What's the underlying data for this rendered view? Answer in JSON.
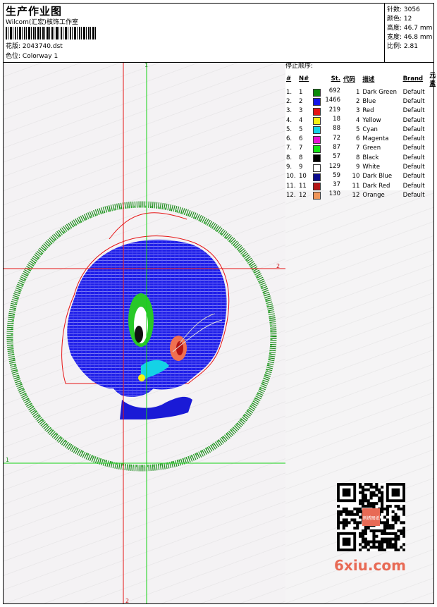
{
  "header": {
    "title": "生产作业图",
    "company": "Wilcom(汇宏)核饰工作室",
    "design_label": "花版:",
    "design_file": "2043740.dst",
    "colorway_label": "色位:",
    "colorway": "Colorway 1"
  },
  "stats": {
    "stitches_label": "针数:",
    "stitches": "3056",
    "colors_label": "颜色:",
    "colors": "12",
    "height_label": "高度:",
    "height": "46.7 mm",
    "width_label": "宽度:",
    "width": "46.8 mm",
    "ratio_label": "比例:",
    "ratio": "2.81"
  },
  "stop_sequence": {
    "title": "停止顺序:",
    "headers": [
      "#",
      "N#",
      "St.",
      "代码",
      "描述",
      "Brand",
      "元素"
    ],
    "rows": [
      {
        "idx": "1.",
        "n": "1",
        "st": "692",
        "code": "1",
        "desc": "Dark Green",
        "brand": "Default",
        "color": "#0a8a0a"
      },
      {
        "idx": "2.",
        "n": "2",
        "st": "1466",
        "code": "2",
        "desc": "Blue",
        "brand": "Default",
        "color": "#1414e6"
      },
      {
        "idx": "3.",
        "n": "3",
        "st": "219",
        "code": "3",
        "desc": "Red",
        "brand": "Default",
        "color": "#e61414"
      },
      {
        "idx": "4.",
        "n": "4",
        "st": "18",
        "code": "4",
        "desc": "Yellow",
        "brand": "Default",
        "color": "#f5f014"
      },
      {
        "idx": "5.",
        "n": "5",
        "st": "88",
        "code": "5",
        "desc": "Cyan",
        "brand": "Default",
        "color": "#14d2e6"
      },
      {
        "idx": "6.",
        "n": "6",
        "st": "72",
        "code": "6",
        "desc": "Magenta",
        "brand": "Default",
        "color": "#e614d2"
      },
      {
        "idx": "7.",
        "n": "7",
        "st": "87",
        "code": "7",
        "desc": "Green",
        "brand": "Default",
        "color": "#14e614"
      },
      {
        "idx": "8.",
        "n": "8",
        "st": "57",
        "code": "8",
        "desc": "Black",
        "brand": "Default",
        "color": "#000000"
      },
      {
        "idx": "9.",
        "n": "9",
        "st": "129",
        "code": "9",
        "desc": "White",
        "brand": "Default",
        "color": "#ffffff"
      },
      {
        "idx": "10.",
        "n": "10",
        "st": "59",
        "code": "10",
        "desc": "Dark Blue",
        "brand": "Default",
        "color": "#0a0a8c"
      },
      {
        "idx": "11.",
        "n": "11",
        "st": "37",
        "code": "11",
        "desc": "Dark Red",
        "brand": "Default",
        "color": "#b41414"
      },
      {
        "idx": "12.",
        "n": "12",
        "st": "130",
        "code": "12",
        "desc": "Orange",
        "brand": "Default",
        "color": "#f0965a"
      }
    ]
  },
  "guides": {
    "v1": "1",
    "h2": "2",
    "h1": "1",
    "v2": "2"
  },
  "watermark": "6xiu.com",
  "qr_badge": "刺绣图纸"
}
